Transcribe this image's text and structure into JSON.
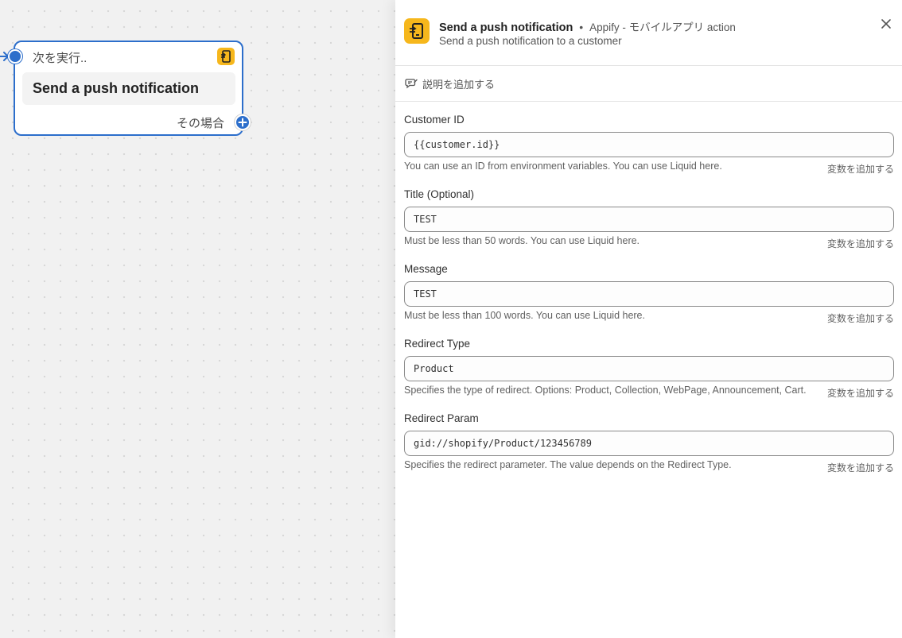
{
  "canvas": {
    "node": {
      "header": "次を実行..",
      "title": "Send a push notification",
      "footer": "その場合",
      "app_icon": "appify-phone-icon",
      "in_port_icon": "arrow-right-icon",
      "out_port_icon": "plus-icon"
    }
  },
  "panel": {
    "title": "Send a push notification",
    "separator": "•",
    "app_name": "Appify - モバイルアプリ action",
    "subtitle": "Send a push notification to a customer",
    "app_icon": "appify-phone-icon",
    "close_icon": "close-icon",
    "add_description": "説明を追加する",
    "add_description_icon": "comment-edit-icon",
    "fields": [
      {
        "label": "Customer ID",
        "value": "{{customer.id}}",
        "help": "You can use an ID from environment variables. You can use Liquid here.",
        "var_link": "変数を追加する"
      },
      {
        "label": "Title (Optional)",
        "value": "TEST",
        "help": "Must be less than 50 words. You can use Liquid here.",
        "var_link": "変数を追加する"
      },
      {
        "label": "Message",
        "value": "TEST",
        "help": "Must be less than 100 words. You can use Liquid here.",
        "var_link": "変数を追加する"
      },
      {
        "label": "Redirect Type",
        "value": "Product",
        "help": "Specifies the type of redirect. Options: Product, Collection, WebPage, Announcement, Cart.",
        "var_link": "変数を追加する"
      },
      {
        "label": "Redirect Param",
        "value": "gid://shopify/Product/123456789",
        "help": "Specifies the redirect parameter. The value depends on the Redirect Type.",
        "var_link": "変数を追加する"
      }
    ]
  },
  "colors": {
    "accent": "#2c6ecb",
    "app_icon_bg": "#f6b71c",
    "canvas_bg": "#f1f1f1"
  }
}
